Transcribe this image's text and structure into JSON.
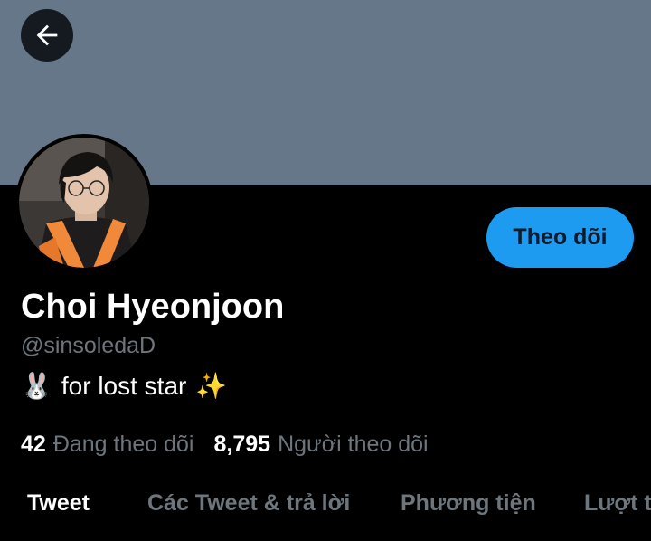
{
  "header": {
    "back_icon": "arrow-left-icon",
    "banner_color": "#66778a"
  },
  "profile": {
    "display_name": "Choi Hyeonjoon",
    "handle": "@sinsoledaD",
    "bio_emoji_start": "🐰",
    "bio_text": "for lost star",
    "bio_emoji_end": "✨",
    "follow_label": "Theo dõi",
    "follow_color": "#1d9bf0"
  },
  "stats": {
    "following_count": "42",
    "following_label": "Đang theo dõi",
    "followers_count": "8,795",
    "followers_label": "Người theo dõi"
  },
  "tabs": [
    {
      "label": "Tweet"
    },
    {
      "label": "Các Tweet & trả lời"
    },
    {
      "label": "Phương tiện"
    },
    {
      "label": "Lượt thích"
    }
  ]
}
